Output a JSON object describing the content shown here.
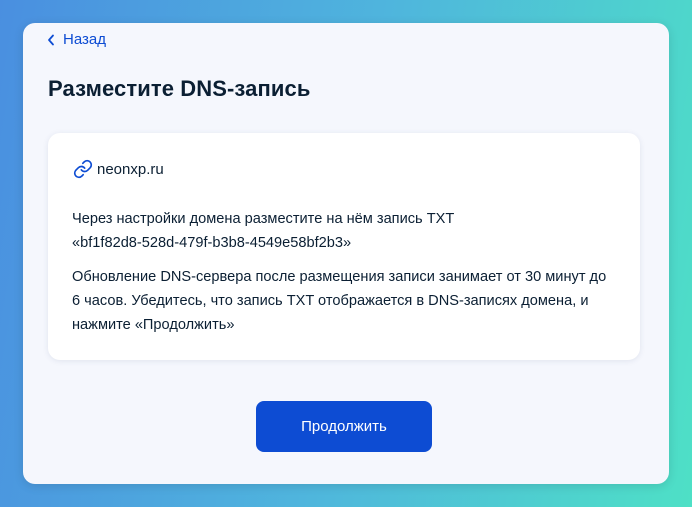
{
  "nav": {
    "back_label": "Назад"
  },
  "page": {
    "title": "Разместите DNS-запись"
  },
  "card": {
    "domain": "neonxp.ru",
    "domain_icon": "link-icon",
    "instruction_line1": "Через настройки домена разместите на нём запись TXT",
    "txt_record": "«bf1f82d8-528d-479f-b3b8-4549e58bf2b3»",
    "note": "Обновление DNS-сервера после размещения записи занимает от 30 минут до 6 часов. Убедитесь, что запись TXT отображается в DNS-записях домена, и нажмите «Продолжить»"
  },
  "actions": {
    "continue_label": "Продолжить"
  },
  "colors": {
    "accent": "#0d4cd3",
    "text": "#0b1f33",
    "panel_background": "#f5f7fd",
    "card_background": "#ffffff"
  }
}
